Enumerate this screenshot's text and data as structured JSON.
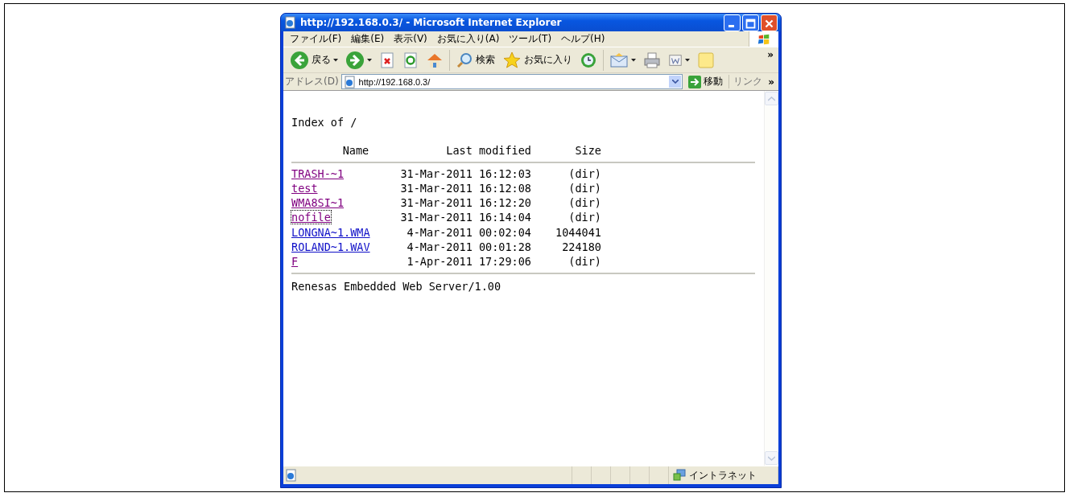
{
  "window": {
    "title": "http://192.168.0.3/ - Microsoft Internet Explorer"
  },
  "menu": [
    "ファイル(F)",
    "編集(E)",
    "表示(V)",
    "お気に入り(A)",
    "ツール(T)",
    "ヘルプ(H)"
  ],
  "toolbar": [
    {
      "kind": "back",
      "label": "戻る",
      "dropdown": true
    },
    {
      "kind": "forward",
      "dropdown": true
    },
    {
      "kind": "stop",
      "dropdown": false
    },
    {
      "kind": "refresh",
      "dropdown": false
    },
    {
      "kind": "home",
      "dropdown": false
    },
    {
      "kind": "search",
      "label": "検索",
      "dropdown": false
    },
    {
      "kind": "favorites",
      "label": "お気に入り",
      "dropdown": false
    },
    {
      "kind": "history",
      "dropdown": false
    },
    {
      "kind": "mail",
      "dropdown": true
    },
    {
      "kind": "print",
      "dropdown": false
    },
    {
      "kind": "word",
      "dropdown": true
    },
    {
      "kind": "note",
      "dropdown": false
    }
  ],
  "toolbar_more": "»",
  "address": {
    "label": "アドレス(D)",
    "value": "http://192.168.0.3/",
    "go_label": "移動",
    "links_label": "リンク",
    "links_more": "»"
  },
  "page": {
    "heading": "Index of /",
    "columns": [
      "Name",
      "Last modified",
      "Size"
    ],
    "rows": [
      {
        "name": "TRASH-~1",
        "modified": "31-Mar-2011 16:12:03",
        "size": "(dir)",
        "visited": true,
        "focused": false
      },
      {
        "name": "test",
        "modified": "31-Mar-2011 16:12:08",
        "size": "(dir)",
        "visited": true,
        "focused": false
      },
      {
        "name": "WMA8SI~1",
        "modified": "31-Mar-2011 16:12:20",
        "size": "(dir)",
        "visited": true,
        "focused": false
      },
      {
        "name": "nofile",
        "modified": "31-Mar-2011 16:14:04",
        "size": "(dir)",
        "visited": true,
        "focused": true
      },
      {
        "name": "LONGNA~1.WMA",
        "modified": "4-Mar-2011 00:02:04",
        "size": "1044041",
        "visited": false,
        "focused": false
      },
      {
        "name": "ROLAND~1.WAV",
        "modified": "4-Mar-2011 00:01:28",
        "size": "224180",
        "visited": false,
        "focused": false
      },
      {
        "name": "F",
        "modified": "1-Apr-2011 17:29:06",
        "size": "(dir)",
        "visited": true,
        "focused": false
      }
    ],
    "footer": "Renesas Embedded Web Server/1.00"
  },
  "status_bar": {
    "zone": "イントラネット"
  }
}
